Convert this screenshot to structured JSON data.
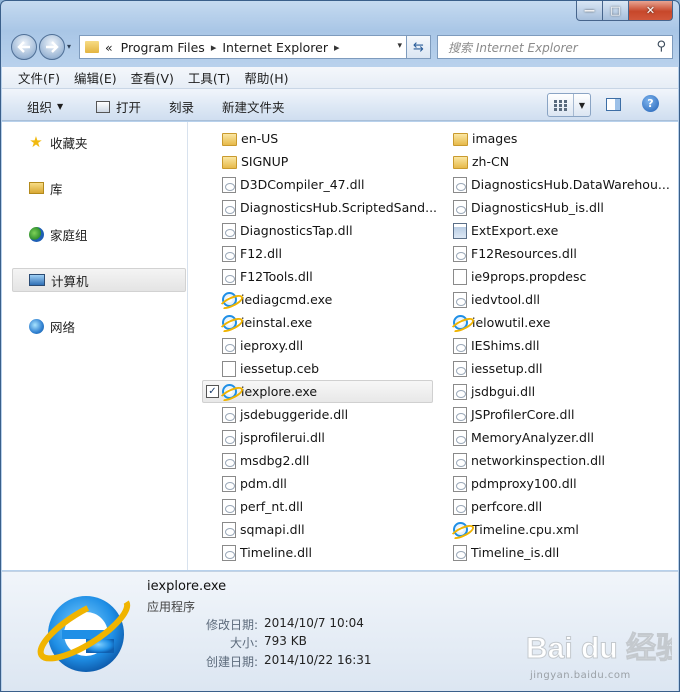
{
  "window": {
    "controls": {
      "minimize": "—",
      "maximize": "□",
      "close": "✕"
    }
  },
  "nav": {
    "back_icon": "back-arrow-icon",
    "forward_icon": "forward-arrow-icon",
    "history_glyph": "▾"
  },
  "address": {
    "overflow": "«",
    "parts": [
      "Program Files",
      "Internet Explorer"
    ],
    "separator": "▸",
    "dropdown_glyph": "▾",
    "refresh_glyph": "⇆"
  },
  "search": {
    "placeholder": "搜索 Internet Explorer",
    "icon_glyph": "⚲"
  },
  "menu": [
    "文件(F)",
    "编辑(E)",
    "查看(V)",
    "工具(T)",
    "帮助(H)"
  ],
  "commands": {
    "organize": "组织",
    "open": "打开",
    "burn": "刻录",
    "new_folder": "新建文件夹",
    "dropdown_glyph": "▼",
    "help_glyph": "?"
  },
  "nav_pane": [
    {
      "label": "收藏夹",
      "icon": "favorites-star-icon"
    },
    {
      "label": "库",
      "icon": "libraries-icon"
    },
    {
      "label": "家庭组",
      "icon": "homegroup-icon"
    },
    {
      "label": "计算机",
      "icon": "computer-icon",
      "selected": true
    },
    {
      "label": "网络",
      "icon": "network-icon"
    }
  ],
  "files_col_a": [
    {
      "name": "en-US",
      "type": "folder"
    },
    {
      "name": "SIGNUP",
      "type": "folder"
    },
    {
      "name": "D3DCompiler_47.dll",
      "type": "dll"
    },
    {
      "name": "DiagnosticsHub.ScriptedSand...",
      "type": "dll"
    },
    {
      "name": "DiagnosticsTap.dll",
      "type": "dll"
    },
    {
      "name": "F12.dll",
      "type": "dll"
    },
    {
      "name": "F12Tools.dll",
      "type": "dll"
    },
    {
      "name": "iediagcmd.exe",
      "type": "ie"
    },
    {
      "name": "ieinstal.exe",
      "type": "ie"
    },
    {
      "name": "ieproxy.dll",
      "type": "dll"
    },
    {
      "name": "iessetup.ceb",
      "type": "generic"
    },
    {
      "name": "iexplore.exe",
      "type": "ie",
      "selected": true
    },
    {
      "name": "jsdebuggeride.dll",
      "type": "dll"
    },
    {
      "name": "jsprofilerui.dll",
      "type": "dll"
    },
    {
      "name": "msdbg2.dll",
      "type": "dll"
    },
    {
      "name": "pdm.dll",
      "type": "dll"
    },
    {
      "name": "perf_nt.dll",
      "type": "dll"
    },
    {
      "name": "sqmapi.dll",
      "type": "dll"
    },
    {
      "name": "Timeline.dll",
      "type": "dll"
    }
  ],
  "files_col_b": [
    {
      "name": "images",
      "type": "folder"
    },
    {
      "name": "zh-CN",
      "type": "folder"
    },
    {
      "name": "DiagnosticsHub.DataWarehou...",
      "type": "dll"
    },
    {
      "name": "DiagnosticsHub_is.dll",
      "type": "dll"
    },
    {
      "name": "ExtExport.exe",
      "type": "exe"
    },
    {
      "name": "F12Resources.dll",
      "type": "dll"
    },
    {
      "name": "ie9props.propdesc",
      "type": "generic"
    },
    {
      "name": "iedvtool.dll",
      "type": "dll"
    },
    {
      "name": "ielowutil.exe",
      "type": "ie"
    },
    {
      "name": "IEShims.dll",
      "type": "dll"
    },
    {
      "name": "iessetup.dll",
      "type": "dll"
    },
    {
      "name": "jsdbgui.dll",
      "type": "dll"
    },
    {
      "name": "JSProfilerCore.dll",
      "type": "dll"
    },
    {
      "name": "MemoryAnalyzer.dll",
      "type": "dll"
    },
    {
      "name": "networkinspection.dll",
      "type": "dll"
    },
    {
      "name": "pdmproxy100.dll",
      "type": "dll"
    },
    {
      "name": "perfcore.dll",
      "type": "dll"
    },
    {
      "name": "Timeline.cpu.xml",
      "type": "ie"
    },
    {
      "name": "Timeline_is.dll",
      "type": "dll"
    }
  ],
  "details": {
    "name": "iexplore.exe",
    "type": "应用程序",
    "modified_label": "修改日期:",
    "modified_value": "2014/10/7 10:04",
    "size_label": "大小:",
    "size_value": "793 KB",
    "created_label": "创建日期:",
    "created_value": "2014/10/22 16:31"
  },
  "watermark": {
    "text": "Bai du 经验",
    "sub": "jingyan.baidu.com"
  },
  "colors": {
    "accent": "#1f8fe6",
    "ie_ring": "#f0b400",
    "window_frame": "#a9c6e6"
  }
}
